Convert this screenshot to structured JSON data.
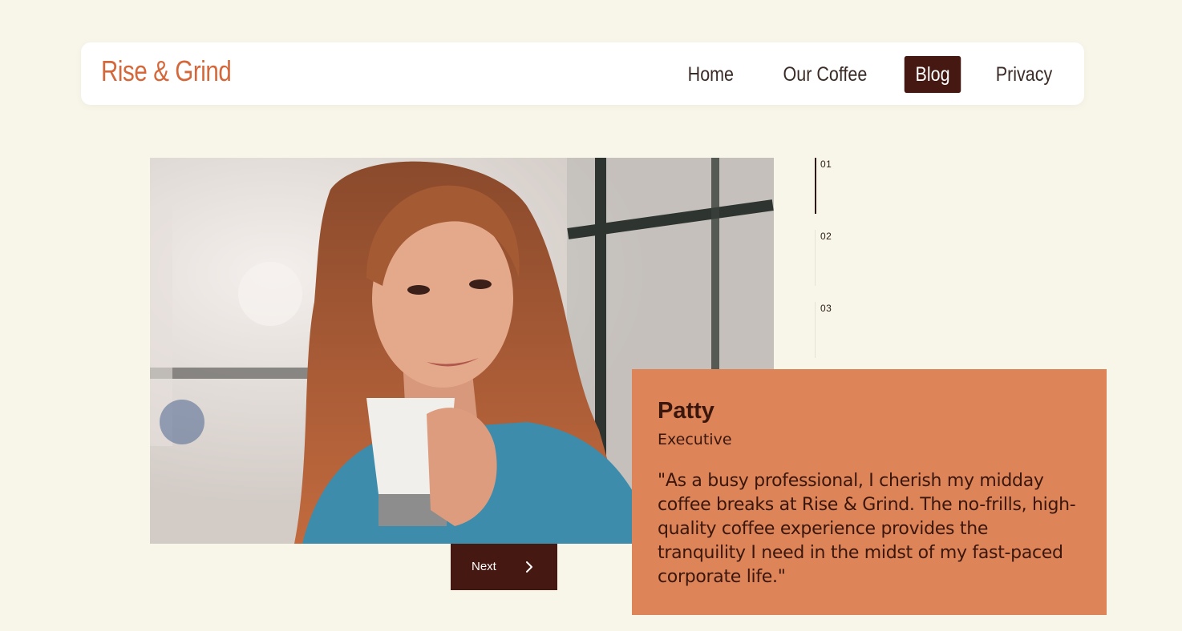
{
  "header": {
    "brand": "Rise & Grind",
    "nav": [
      {
        "label": "Home",
        "active": false
      },
      {
        "label": "Our Coffee",
        "active": false
      },
      {
        "label": "Blog",
        "active": true
      },
      {
        "label": "Privacy",
        "active": false
      }
    ]
  },
  "slider": {
    "indicators": [
      "01",
      "02",
      "03"
    ],
    "active_index": 0,
    "next_label": "Next",
    "next_icon": "chevron-right-icon"
  },
  "testimonial": {
    "name": "Patty",
    "role": "Executive",
    "quote": "\"As a busy professional, I cherish my midday coffee breaks at Rise & Grind. The no-frills, high-quality coffee experience provides the tranquility I need in the midst of my fast-paced corporate life.\""
  },
  "colors": {
    "background": "#f8f6e8",
    "brand": "#d5683a",
    "dark": "#451912",
    "card": "#dd8558"
  }
}
